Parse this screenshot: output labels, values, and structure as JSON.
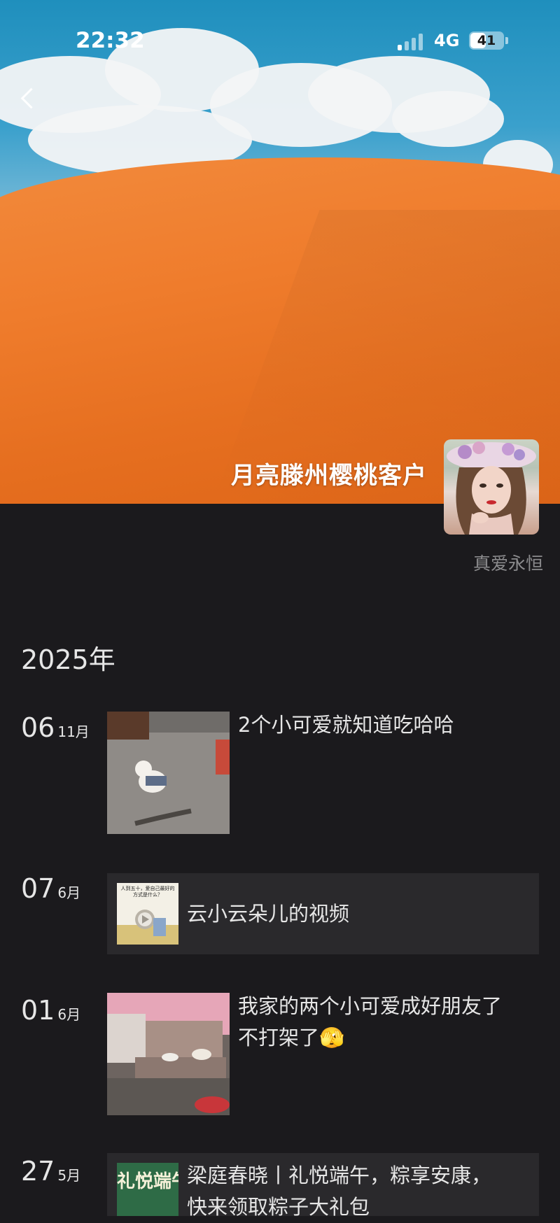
{
  "status_bar": {
    "time": "22:32",
    "network": "4G",
    "battery": "41"
  },
  "profile": {
    "name": "月亮滕州樱桃客户",
    "signature": "真爱永恒"
  },
  "timeline": {
    "year": "2025年",
    "entries": [
      {
        "day": "06",
        "month": "11月",
        "text": "2个小可爱就知道吃哈哈"
      },
      {
        "day": "07",
        "month": "6月",
        "text": "云小云朵儿的视频",
        "thumb_caption": "人到五十，爱自己最好的方式是什么？"
      },
      {
        "day": "01",
        "month": "6月",
        "text_line1": "我家的两个小可爱成好朋友了",
        "text_line2": "不打架了🫣"
      },
      {
        "day": "27",
        "month": "5月",
        "text_line1": "梁庭春晓丨礼悦端午，粽享安康，",
        "text_line2": "快来领取粽子大礼包",
        "thumb_caption": "礼悦端午 粽享安康"
      }
    ]
  }
}
